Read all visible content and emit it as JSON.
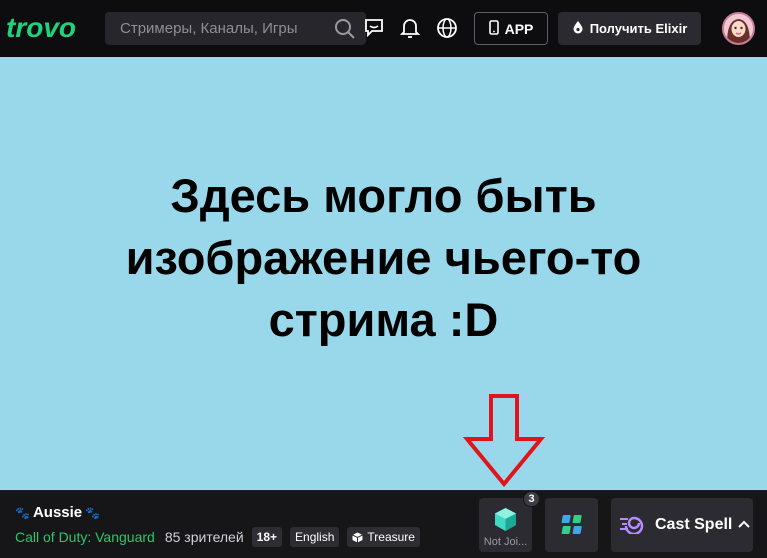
{
  "header": {
    "logo_text": "trovo",
    "search_placeholder": "Стримеры, Каналы, Игры",
    "app_label": "APP",
    "elixir_label": "Получить Elixir"
  },
  "main": {
    "headline_lines": [
      "Здесь могло быть",
      "изображение чьего-то",
      "стрима :D"
    ]
  },
  "footer": {
    "streamer_name": "Aussie",
    "game": "Call of Duty: Vanguard",
    "viewers": "85 зрителей",
    "tags": [
      "18+",
      "English",
      "Treasure"
    ],
    "join_label": "Not Joi...",
    "join_badge_count": "3",
    "cast_spell_label": "Cast Spell"
  },
  "colors": {
    "brand": "#1fd27e",
    "main_bg": "#99d8ea",
    "game_link": "#27c96b",
    "arrow": "#e0141b"
  },
  "icons": [
    "search-icon",
    "chat-icon",
    "bell-icon",
    "globe-icon",
    "phone-icon",
    "elixir-drop-icon",
    "avatar",
    "paw-icon",
    "treasure-box-icon",
    "cube-icon",
    "apps-icon",
    "spell-swirl-icon",
    "chevron-up-icon",
    "down-arrow-icon"
  ]
}
